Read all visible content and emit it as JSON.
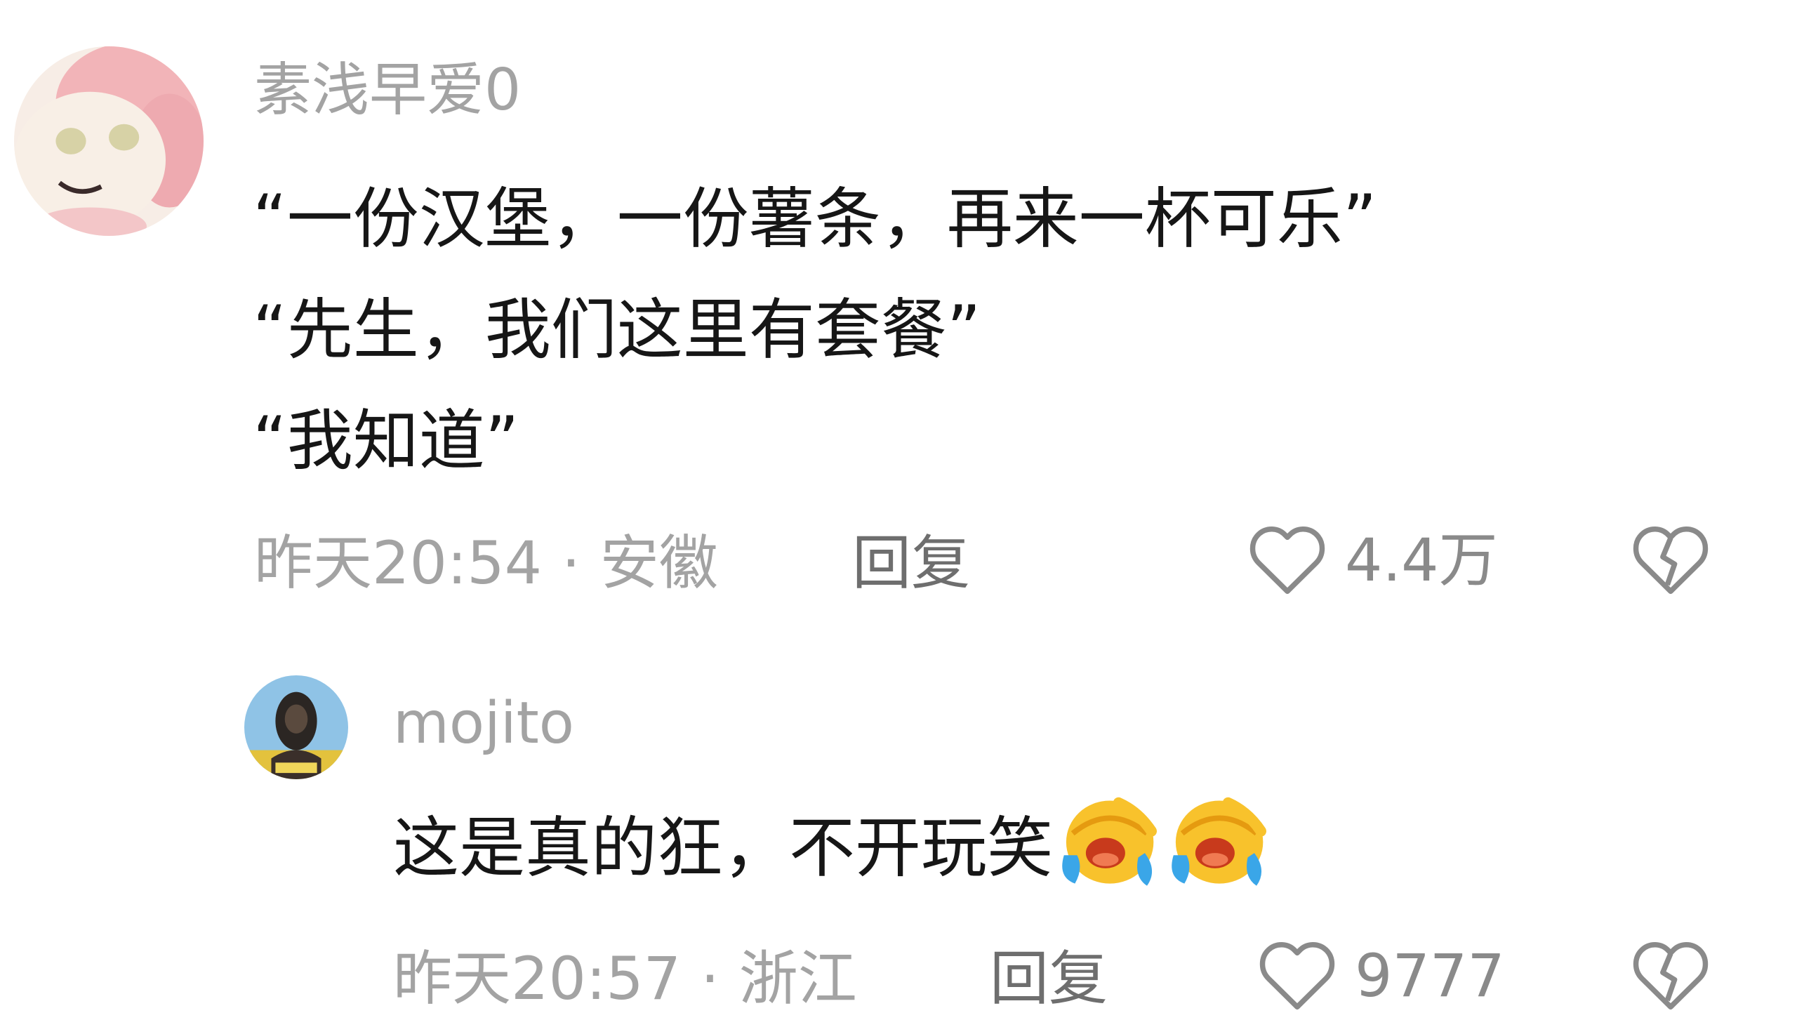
{
  "comments": [
    {
      "username": "素浅早爱0",
      "lines": [
        "“一份汉堡，一份薯条，再来一杯可乐”",
        "“先生，我们这里有套餐”",
        "“我知道”"
      ],
      "time": "昨天20:54",
      "separator": "·",
      "location": "安徽",
      "reply_label": "回复",
      "like_count": "4.4万",
      "avatar_icon": "anime-girl-avatar",
      "like_icon": "heart-outline-icon",
      "dislike_icon": "broken-heart-icon"
    },
    {
      "username": "mojito",
      "text": "这是真的狂，不开玩笑",
      "emoji": [
        "rofl-crying-emoji",
        "rofl-crying-emoji"
      ],
      "time": "昨天20:57",
      "separator": "·",
      "location": "浙江",
      "reply_label": "回复",
      "like_count": "9777",
      "avatar_icon": "user-photo-avatar",
      "like_icon": "heart-outline-icon",
      "dislike_icon": "broken-heart-icon"
    }
  ],
  "colors": {
    "username": "#a3a3a3",
    "body_text": "#161616",
    "meta": "#a3a3a3",
    "reply": "#6e6e6e",
    "icon": "#8a8a8a"
  }
}
